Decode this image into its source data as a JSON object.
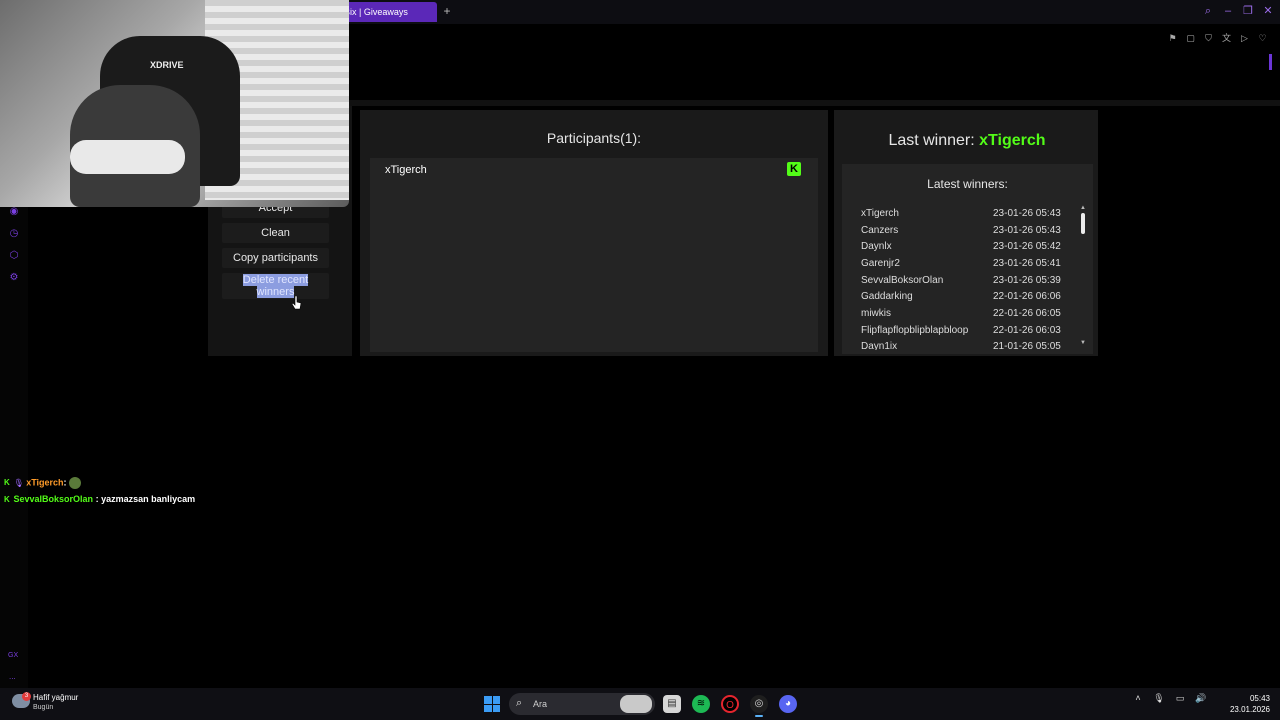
{
  "browser": {
    "active_tab": "Bix | Giveaways",
    "new_tab_symbol": "+",
    "window_controls": [
      "search-icon",
      "minimize-icon",
      "restore-icon",
      "close-icon"
    ],
    "toolbar_icons": [
      "bookmark-icon",
      "screenshot-icon",
      "shield-icon",
      "translate-icon",
      "play-icon",
      "heart-icon"
    ]
  },
  "controls": {
    "accept": "Accept",
    "clean": "Clean",
    "copy": "Copy participants",
    "delete_line1": "Delete recent",
    "delete_line2": "winners"
  },
  "participants": {
    "title": "Participants(1):",
    "items": [
      {
        "name": "xTigerch",
        "platform_icon": "kick-icon"
      }
    ]
  },
  "winners": {
    "last_winner_prefix": "Last winner:",
    "last_winner_name": "xTigerch",
    "latest_title": "Latest winners:",
    "list": [
      {
        "name": "xTigerch",
        "date": "23-01-26 05:43"
      },
      {
        "name": "Canzers",
        "date": "23-01-26 05:43"
      },
      {
        "name": "Daynlx",
        "date": "23-01-26 05:42"
      },
      {
        "name": "Garenjr2",
        "date": "23-01-26 05:41"
      },
      {
        "name": "SevvalBoksorOlan",
        "date": "23-01-26 05:39"
      },
      {
        "name": "Gaddarking",
        "date": "22-01-26 06:06"
      },
      {
        "name": "miwkis",
        "date": "22-01-26 06:05"
      },
      {
        "name": "Flipflapflopblipblapbloop",
        "date": "22-01-26 06:03"
      },
      {
        "name": "Dayn1ix",
        "date": "21-01-26 05:05"
      }
    ]
  },
  "chat": [
    {
      "user": "xTigerch",
      "separator": ":",
      "message": ""
    },
    {
      "user": "SevvalBoksorOlan",
      "separator": ":",
      "message": "yazmazsan banliycam"
    }
  ],
  "webcam": {
    "chair_brand": "XDRIVE"
  },
  "sidebar": {
    "gx_label": "GX",
    "more": "..."
  },
  "taskbar": {
    "weather_badge": "3",
    "weather_text": "Hafif yağmur",
    "weather_sub": "Bugün",
    "search_placeholder": "Ara",
    "time": "05:43",
    "date": "23.01.2026"
  },
  "colors": {
    "accent": "#53fc18",
    "browser_accent": "#5b28b8",
    "panel_bg": "#1a1a1a"
  }
}
